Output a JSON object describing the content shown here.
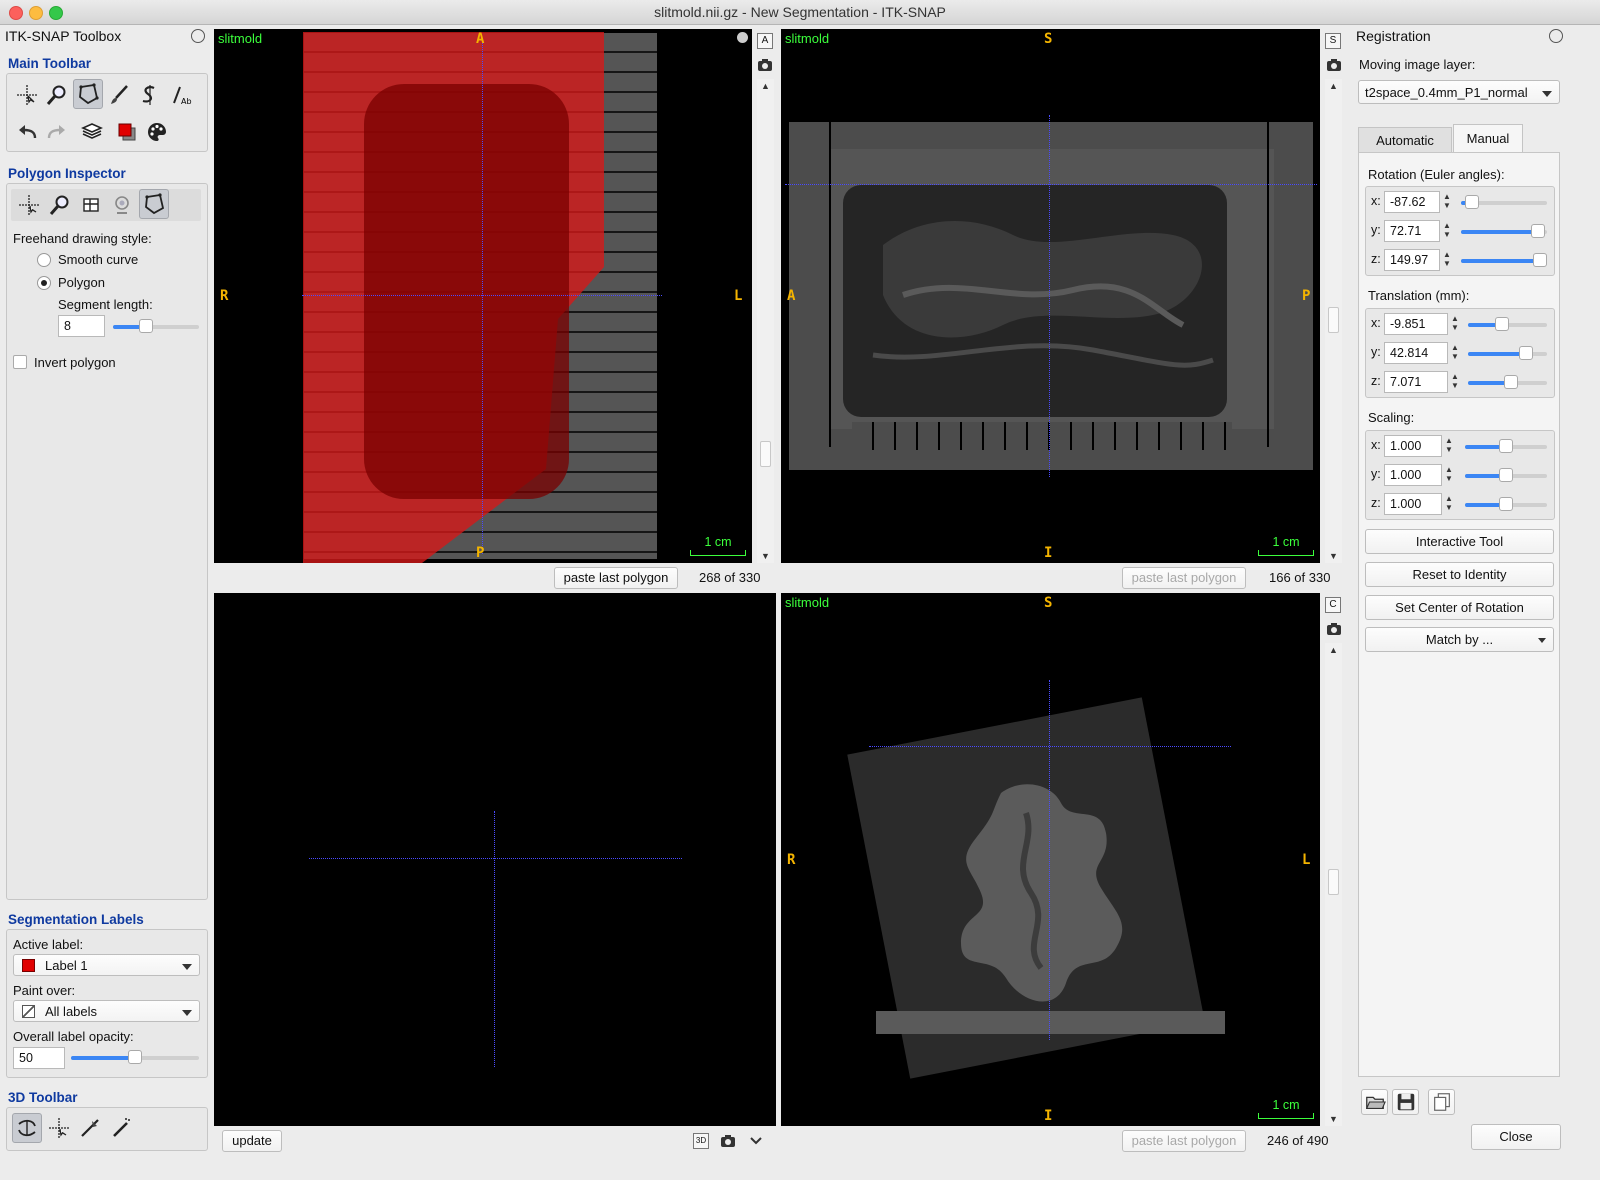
{
  "window": {
    "title": "slitmold.nii.gz - New Segmentation - ITK-SNAP"
  },
  "toolbox": {
    "title": "ITK-SNAP Toolbox",
    "main_toolbar": "Main Toolbar",
    "polygon_inspector": "Polygon Inspector",
    "freehand_label": "Freehand drawing style:",
    "smooth_curve": "Smooth curve",
    "polygon": "Polygon",
    "segment_length_label": "Segment length:",
    "segment_length": "8",
    "segment_length_fraction": 0.38,
    "invert_polygon": "Invert polygon",
    "seg_labels_title": "Segmentation Labels",
    "active_label_title": "Active label:",
    "active_label": "Label 1",
    "paint_over_title": "Paint over:",
    "paint_over": "All labels",
    "opacity_title": "Overall label opacity:",
    "opacity": "50",
    "opacity_fraction": 0.5,
    "toolbar_3d": "3D Toolbar",
    "label_color": "#e00000"
  },
  "views": {
    "axial": {
      "layer": "slitmold",
      "top": "A",
      "bottom": "P",
      "left": "R",
      "right": "L",
      "scale": "1 cm",
      "paste": "paste last polygon",
      "slice": "268 of 330",
      "mode_icon": "A"
    },
    "sagittal": {
      "layer": "slitmold",
      "top": "S",
      "bottom": "I",
      "left": "A",
      "right": "P",
      "scale": "1 cm",
      "paste": "paste last polygon",
      "slice": "166 of 330",
      "mode_icon": "S"
    },
    "coronal": {
      "layer": "slitmold",
      "top": "S",
      "bottom": "I",
      "left": "R",
      "right": "L",
      "scale": "1 cm",
      "paste": "paste last polygon",
      "slice": "246 of 490",
      "mode_icon": "C"
    },
    "three_d": {
      "update": "update",
      "mode_icon": "3D"
    }
  },
  "registration": {
    "title": "Registration",
    "moving_label": "Moving image layer:",
    "moving_layer": "t2space_0.4mm_P1_normal",
    "tab_automatic": "Automatic",
    "tab_manual": "Manual",
    "rotation_title": "Rotation (Euler angles):",
    "rotation": [
      {
        "axis": "x:",
        "value": "-87.62",
        "fraction": 0.13
      },
      {
        "axis": "y:",
        "value": "72.71",
        "fraction": 0.9
      },
      {
        "axis": "z:",
        "value": "149.97",
        "fraction": 0.92
      }
    ],
    "translation_title": "Translation (mm):",
    "translation": [
      {
        "axis": "x:",
        "value": "-9.851",
        "fraction": 0.43
      },
      {
        "axis": "y:",
        "value": "42.814",
        "fraction": 0.74
      },
      {
        "axis": "z:",
        "value": "7.071",
        "fraction": 0.55
      }
    ],
    "scaling_title": "Scaling:",
    "scaling": [
      {
        "axis": "x:",
        "value": "1.000",
        "fraction": 0.5
      },
      {
        "axis": "y:",
        "value": "1.000",
        "fraction": 0.5
      },
      {
        "axis": "z:",
        "value": "1.000",
        "fraction": 0.5
      }
    ],
    "interactive_tool": "Interactive Tool",
    "reset_identity": "Reset to Identity",
    "set_center": "Set Center of Rotation",
    "match_by": "Match by ...",
    "close": "Close"
  }
}
